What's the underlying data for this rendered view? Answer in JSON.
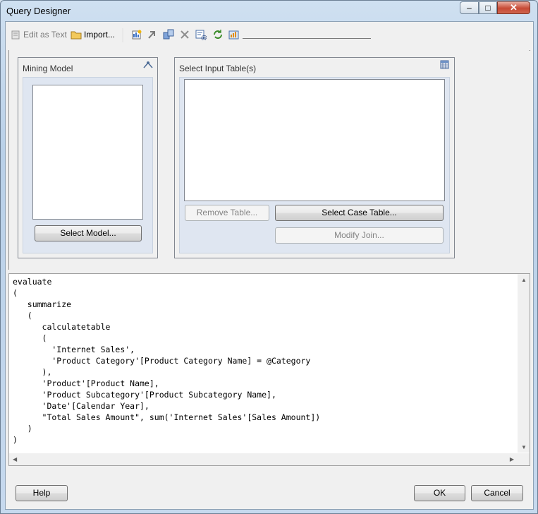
{
  "window": {
    "title": "Query Designer"
  },
  "toolbar": {
    "edit_as_text": "Edit as Text",
    "import": "Import...",
    "icons": [
      "add-table-icon",
      "arrow-icon",
      "copy-icon",
      "delete-icon",
      "parameters-icon",
      "refresh-icon",
      "run-icon"
    ]
  },
  "mining_model": {
    "title": "Mining Model",
    "select_model": "Select Model..."
  },
  "input_tables": {
    "title": "Select Input Table(s)",
    "remove_table": "Remove Table...",
    "select_case_table": "Select Case Table...",
    "modify_join": "Modify Join..."
  },
  "query": {
    "lines": [
      "evaluate",
      "(",
      "   summarize",
      "   (",
      "      calculatetable",
      "      (",
      "        'Internet Sales',",
      "        'Product Category'[Product Category Name] = @Category",
      "      ),",
      "      'Product'[Product Name],",
      "      'Product Subcategory'[Product Subcategory Name],",
      "      'Date'[Calendar Year],",
      "      \"Total Sales Amount\", sum('Internet Sales'[Sales Amount])",
      "   )",
      ")"
    ]
  },
  "footer": {
    "help": "Help",
    "ok": "OK",
    "cancel": "Cancel"
  },
  "colors": {
    "frame": "#b9d0e8",
    "panel_fill": "#dfe6f1",
    "close_button": "#c74a35"
  }
}
